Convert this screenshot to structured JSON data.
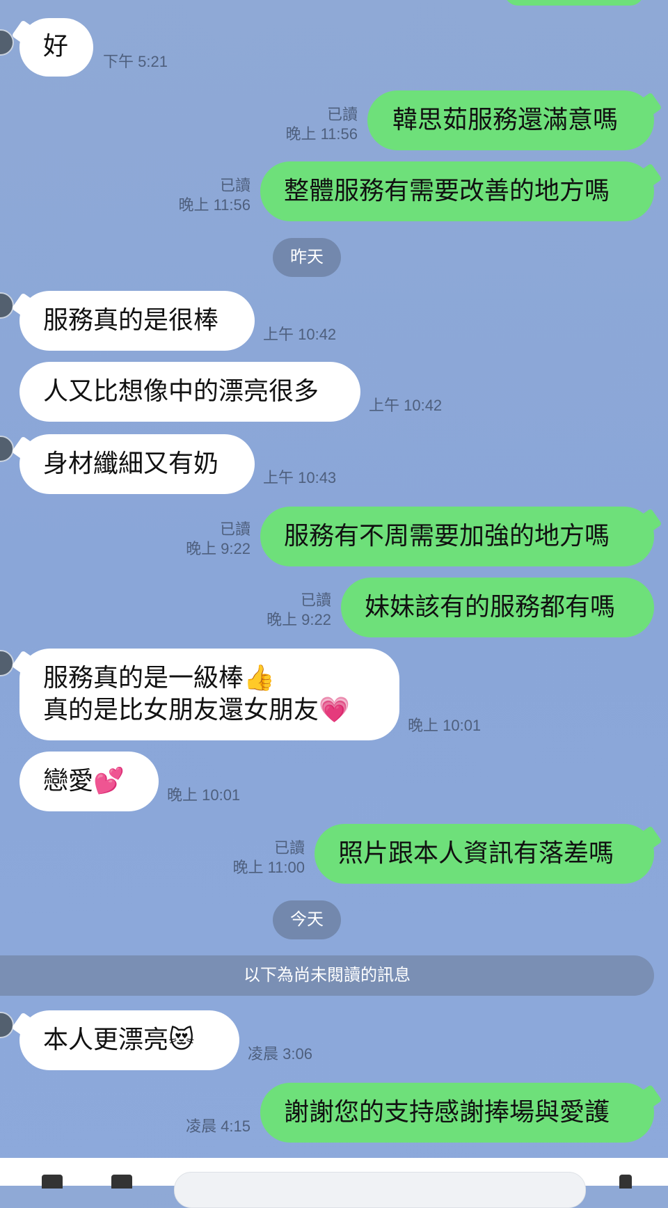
{
  "messages": [
    {
      "side": "in",
      "text": "好",
      "time": "下午 5:21"
    },
    {
      "side": "out",
      "read": "已讀",
      "time": "晚上 11:56",
      "text": "韓思茹服務還滿意嗎"
    },
    {
      "side": "out",
      "read": "已讀",
      "time": "晚上 11:56",
      "text": "整體服務有需要改善的地方嗎"
    },
    {
      "side": "in",
      "text": "服務真的是很棒",
      "time": "上午 10:42"
    },
    {
      "side": "in",
      "text": "人又比想像中的漂亮很多",
      "time": "上午 10:42"
    },
    {
      "side": "in",
      "text": "身材纖細又有奶",
      "time": "上午 10:43"
    },
    {
      "side": "out",
      "read": "已讀",
      "time": "晚上 9:22",
      "text": "服務有不周需要加強的地方嗎"
    },
    {
      "side": "out",
      "read": "已讀",
      "time": "晚上 9:22",
      "text": "妹妹該有的服務都有嗎"
    },
    {
      "side": "in",
      "line1": "服務真的是一級棒👍",
      "line2": "真的是比女朋友還女朋友💗",
      "time": "晚上 10:01"
    },
    {
      "side": "in",
      "text": "戀愛💕",
      "time": "晚上 10:01"
    },
    {
      "side": "out",
      "read": "已讀",
      "time": "晚上 11:00",
      "text": "照片跟本人資訊有落差嗎"
    },
    {
      "side": "in",
      "text": "本人更漂亮😻",
      "time": "凌晨 3:06"
    },
    {
      "side": "out",
      "time": "凌晨 4:15",
      "text": "謝謝您的支持感謝捧場與愛護"
    }
  ],
  "dividers": {
    "yesterday": "昨天",
    "today": "今天",
    "unread": "以下為尚未閱讀的訊息"
  },
  "colors": {
    "background": "#8fa9d6",
    "out_bubble": "#6ee07a",
    "in_bubble": "#ffffff",
    "pill": "#7388ad"
  }
}
